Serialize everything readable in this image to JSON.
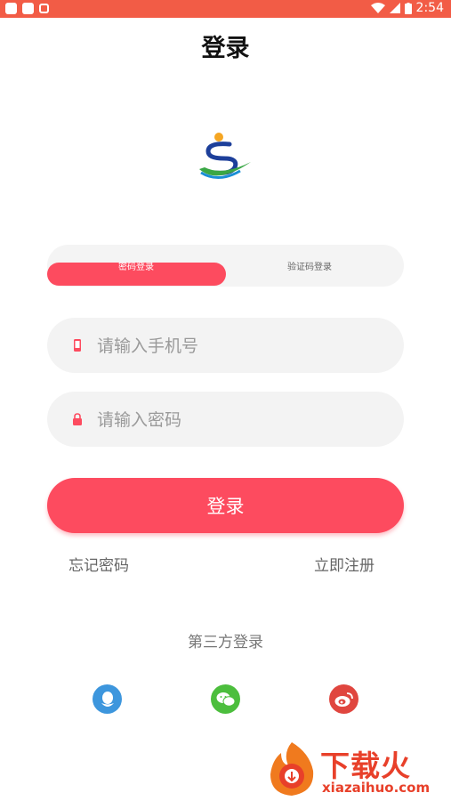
{
  "status_bar": {
    "time": "2:54"
  },
  "header": {
    "title": "登录"
  },
  "tabs": [
    {
      "label": "密码登录",
      "active": true
    },
    {
      "label": "验证码登录",
      "active": false
    }
  ],
  "form": {
    "phone_placeholder": "请输入手机号",
    "password_placeholder": "请输入密码",
    "login_label": "登录",
    "forgot_label": "忘记密码",
    "register_label": "立即注册"
  },
  "third_party": {
    "title": "第三方登录",
    "providers": [
      {
        "name": "qq-icon",
        "color": "#3d96dd"
      },
      {
        "name": "wechat-icon",
        "color": "#4cbe3d"
      },
      {
        "name": "weibo-icon",
        "color": "#e0463f"
      }
    ]
  },
  "watermark": {
    "cn": "下载火",
    "en": "xiazaihuo.com"
  },
  "colors": {
    "accent": "#fd4b5f",
    "status_bar": "#f25c46",
    "field_bg": "#f3f3f3"
  }
}
